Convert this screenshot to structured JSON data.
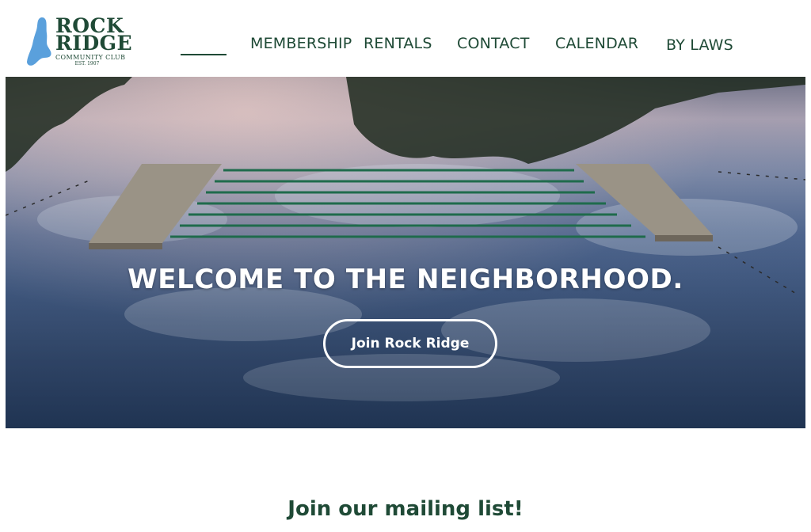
{
  "logo": {
    "line1": "ROCK",
    "line2": "RIDGE",
    "line3": "COMMUNITY CLUB",
    "line4": "EST. 1907",
    "icon": "lake-silhouette-icon"
  },
  "nav": {
    "items": [
      {
        "label": ""
      },
      {
        "label": "MEMBERSHIP"
      },
      {
        "label": "RENTALS"
      },
      {
        "label": "CONTACT"
      },
      {
        "label": "CALENDAR"
      },
      {
        "label": "BY LAWS"
      }
    ]
  },
  "hero": {
    "title": "WELCOME TO THE NEIGHBORHOOD.",
    "button_label": "Join Rock Ridge"
  },
  "mailing": {
    "heading": "Join our mailing list!"
  },
  "colors": {
    "brand_green": "#1f4a36",
    "logo_blue": "#5aa0dc",
    "hero_text": "#ffffff"
  }
}
